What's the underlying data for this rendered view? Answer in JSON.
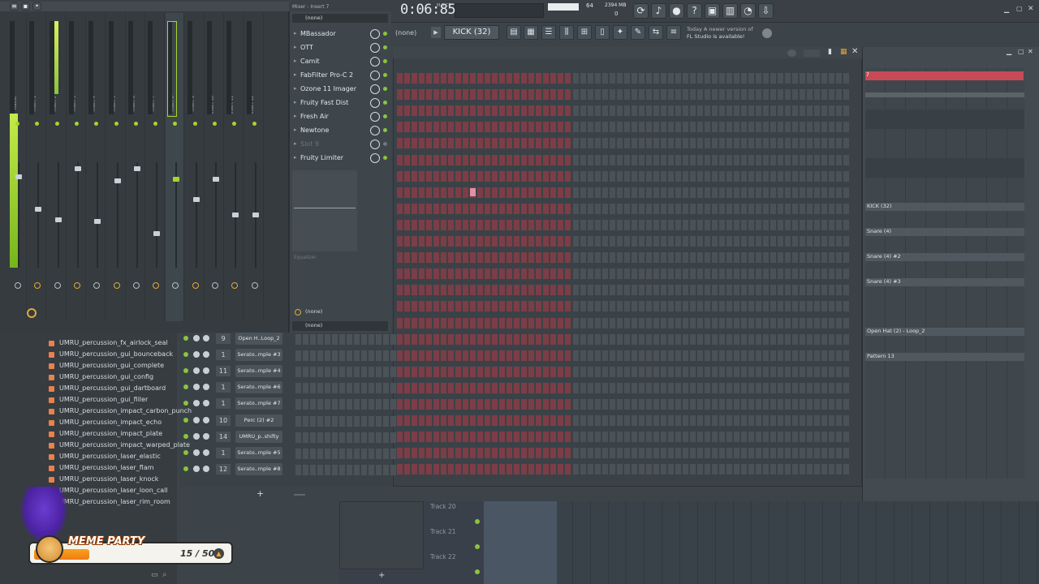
{
  "transport": {
    "time": "0:06:85",
    "ms_label": "M:S:CS",
    "cpu": "64",
    "memory": "2394 MB",
    "polyphony": "0"
  },
  "mixer": {
    "title": "Mixer - Insert 7",
    "strips": [
      "Master",
      "Insert 1",
      "Insert 2",
      "Insert 3",
      "Insert 4",
      "Insert 5",
      "Insert 6",
      "Insert 7",
      "Insert 8",
      "Insert 9",
      "Insert 10",
      "Insert 11",
      "Insert 12"
    ],
    "insert_top": "(none)",
    "slots": [
      {
        "label": "MBassador",
        "enabled": true
      },
      {
        "label": "OTT",
        "enabled": true
      },
      {
        "label": "Camit",
        "enabled": true
      },
      {
        "label": "FabFilter Pro-C 2",
        "enabled": true
      },
      {
        "label": "Ozone 11 Imager",
        "enabled": true
      },
      {
        "label": "Fruity Fast Dist",
        "enabled": true
      },
      {
        "label": "Fresh Air",
        "enabled": true
      },
      {
        "label": "Newtone",
        "enabled": true
      },
      {
        "label": "Slot 9",
        "enabled": false
      },
      {
        "label": "Fruity Limiter",
        "enabled": true
      }
    ],
    "eq_label": "Equalizer",
    "send_1": "(none)",
    "send_2": "(none)"
  },
  "toolbar": {
    "pattern_none": "(none)",
    "pattern": "KICK (32)",
    "news_line1": "Today  A newer version of",
    "news_line2": "FL Studio is available!"
  },
  "channel_rack": {
    "rows": [
      {
        "route": "9",
        "name": "Open H..Loop_2"
      },
      {
        "route": "1",
        "name": "Serato..mple #3"
      },
      {
        "route": "11",
        "name": "Serato..mple #4"
      },
      {
        "route": "1",
        "name": "Serato..mple #6"
      },
      {
        "route": "1",
        "name": "Serato..mple #7"
      },
      {
        "route": "10",
        "name": "Perc (2) #2"
      },
      {
        "route": "14",
        "name": "UMRU_p..shifty"
      },
      {
        "route": "1",
        "name": "Serato..mple #5"
      },
      {
        "route": "12",
        "name": "Serato..mple #8"
      }
    ],
    "add_label": "+"
  },
  "browser": {
    "items": [
      "UMRU_percussion_fx_airlock_seal",
      "UMRU_percussion_gui_bounceback",
      "UMRU_percussion_gui_complete",
      "UMRU_percussion_gui_config",
      "UMRU_percussion_gui_dartboard",
      "UMRU_percussion_gui_filler",
      "UMRU_percussion_impact_carbon_punch",
      "UMRU_percussion_impact_echo",
      "UMRU_percussion_impact_plate",
      "UMRU_percussion_impact_warped_plate",
      "UMRU_percussion_laser_elastic",
      "UMRU_percussion_laser_flam",
      "UMRU_percussion_laser_knock",
      "UMRU_percussion_laser_loon_call",
      "UMRU_percussion_laser_rim_room"
    ]
  },
  "playlist": {
    "top_clip": "7",
    "clips": [
      "KICK (32)",
      "Snare (4)",
      "Snare (4) #2",
      "Snare (4) #3",
      "Open Hat (2) - Loop_2",
      "Pattern 13"
    ]
  },
  "bottom_tracks": [
    "Track 20",
    "Track 21",
    "Track 22"
  ],
  "overlay": {
    "title": "MEME PARTY",
    "count": "15 / 50",
    "progress": 0.3
  },
  "colors": {
    "accent_green": "#a6d62c",
    "step_red": "#7d3d47",
    "playlist_red": "#c94a57"
  },
  "icons": [
    "undo-icon",
    "save-icon",
    "record-icon",
    "help-icon",
    "metronome-icon",
    "close-icon",
    "download-icon"
  ]
}
